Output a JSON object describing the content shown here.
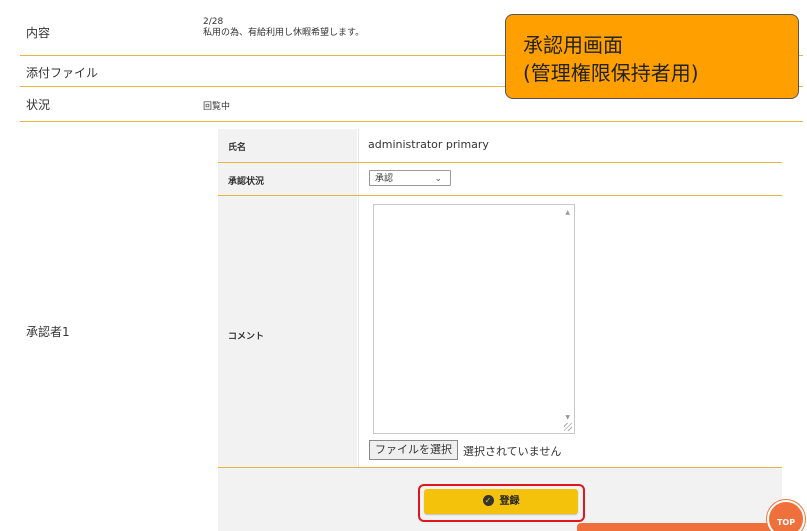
{
  "rows": {
    "content": {
      "label": "内容",
      "value_line1": "2/28",
      "value_line2": "私用の為、有給利用し休暇希望します。"
    },
    "attachment": {
      "label": "添付ファイル"
    },
    "status": {
      "label": "状況",
      "value": "回覧中"
    },
    "approver": {
      "label": "承認者1"
    }
  },
  "approver_table": {
    "name_label": "氏名",
    "name_value": "administrator primary",
    "approval_label": "承認状況",
    "approval_selected": "承認",
    "comment_label": "コメント",
    "file_button_label": "ファイルを選択",
    "file_status": "選択されていません"
  },
  "submit": {
    "label": "登録"
  },
  "callout": {
    "line1": "承認用画面",
    "line2": "(管理権限保持者用)"
  },
  "top_button": {
    "label": "TOP"
  },
  "colors": {
    "accent": "#f5c20b",
    "border": "#e8b445",
    "callout": "#ffa000",
    "highlight": "#e0161f",
    "top_button": "#f0703b"
  }
}
